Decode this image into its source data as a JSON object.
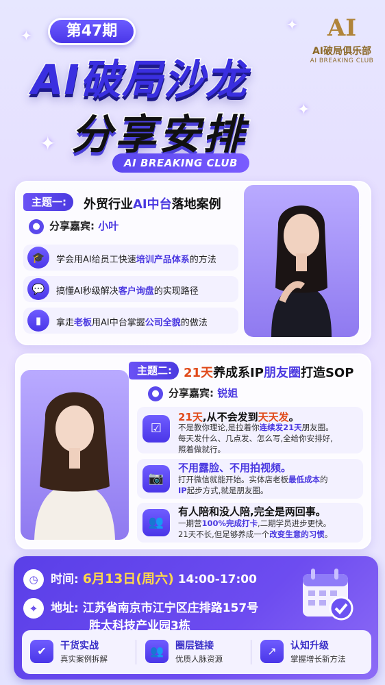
{
  "header": {
    "issue": "第47期",
    "title_line1": "AI破局沙龙",
    "title_line2": "分享安排",
    "club_pill": "AI BREAKING CLUB"
  },
  "logo": {
    "mark": "AI",
    "name_cn": "AI破局俱乐部",
    "name_en": "AI BREAKING CLUB"
  },
  "topic1": {
    "tag": "主题一:",
    "title_pre": "外贸行业",
    "title_hl": "AI中台",
    "title_post": "落地案例",
    "speaker_label": "分享嘉宾:",
    "speaker_name": "小叶",
    "items": [
      {
        "icon": "graduation-cap-icon",
        "pre": "学会用AI给员工快速",
        "hl": "培训产品体系",
        "post": "的方法"
      },
      {
        "icon": "chat-bubble-icon",
        "pre": "搞懂AI秒级解决",
        "hl": "客户询盘",
        "post": "的实现路径"
      },
      {
        "icon": "bar-chart-icon",
        "pre": "拿走",
        "hl": "老板",
        "mid": "用AI中台掌握",
        "hl2": "公司全貌",
        "post": "的做法"
      }
    ]
  },
  "topic2": {
    "tag": "主题二:",
    "title_hl": "21天",
    "title_mid": "养成系IP",
    "title_hl2": "朋友圈",
    "title_post": "打造SOP",
    "speaker_label": "分享嘉宾:",
    "speaker_name": "锐姐",
    "blocks": [
      {
        "icon": "calendar-check-icon",
        "h_hl": "21天",
        "h_mid": ",从不会发到",
        "h_hl2": "天天发",
        "h_post": "。",
        "l1_pre": "不是教你理论,是拉着你",
        "l1_hl": "连续发21天",
        "l1_post": "朋友圈。",
        "l2": "每天发什么、几点发、怎么写,全给你安排好,",
        "l3": "照着做就行。"
      },
      {
        "icon": "camera-icon",
        "h": "不用露脸、不用拍视频。",
        "l1_pre": "打开微信就能开始。实体店老板",
        "l1_hl": "最低成本",
        "l1_post": "的",
        "l2_hl": "IP",
        "l2_post": "起步方式,就是朋友圈。"
      },
      {
        "icon": "people-icon",
        "h": "有人陪和没人陪,完全是两回事。",
        "l1_pre": "一期营",
        "l1_hl": "100%完成打卡",
        "l1_post": ",二期学员进步更快。",
        "l2_pre": "21天不长,但足够养成一个",
        "l2_hl": "改变生意的习惯",
        "l2_post": "。"
      }
    ]
  },
  "event": {
    "time_label": "时间:",
    "date": "6月13日(周六)",
    "hours": "14:00-17:00",
    "addr_label": "地址:",
    "addr_line1": "江苏省南京市江宁区庄排路157号",
    "addr_line2": "胜太科技产业园3栋"
  },
  "features": [
    {
      "icon": "shield-check-icon",
      "title": "干货实战",
      "sub": "真实案例拆解"
    },
    {
      "icon": "group-icon",
      "title": "圈层链接",
      "sub": "优质人脉资源"
    },
    {
      "icon": "growth-chart-icon",
      "title": "认知升级",
      "sub": "掌握增长新方法"
    }
  ],
  "colors": {
    "accent": "#4a38e0",
    "orange": "#e04a1a",
    "gold": "#b0843a"
  }
}
